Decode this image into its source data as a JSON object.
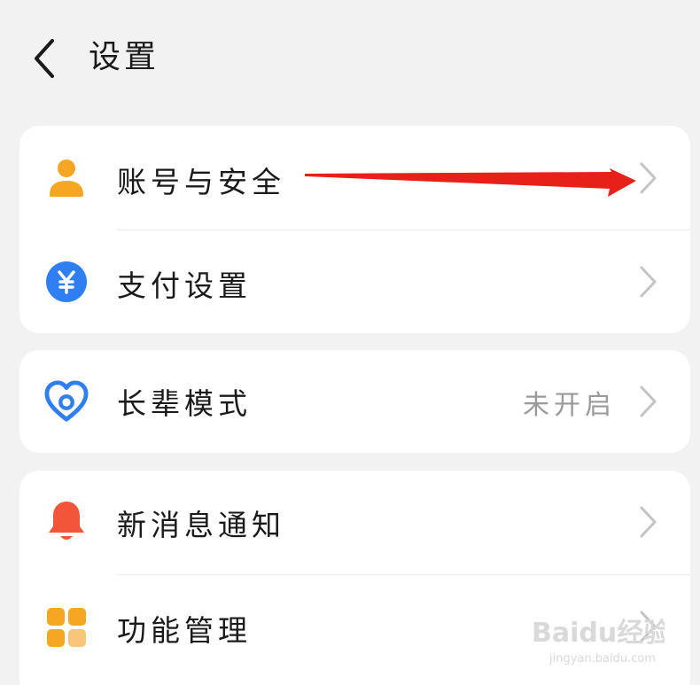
{
  "header": {
    "title": "设置",
    "back_icon": "chevron-left-icon"
  },
  "groups": [
    {
      "items": [
        {
          "label": "账号与安全",
          "icon": "account-icon",
          "icon_color": "#f5a623",
          "value": ""
        },
        {
          "label": "支付设置",
          "icon": "payment-icon",
          "icon_color": "#2f7ff3",
          "value": ""
        }
      ]
    },
    {
      "items": [
        {
          "label": "长辈模式",
          "icon": "elder-mode-icon",
          "icon_color": "#2f7ff3",
          "value": "未开启"
        }
      ]
    },
    {
      "items": [
        {
          "label": "新消息通知",
          "icon": "bell-icon",
          "icon_color": "#f2553a",
          "value": ""
        },
        {
          "label": "功能管理",
          "icon": "grid-icon",
          "icon_color": "#f5a623",
          "value": ""
        }
      ]
    }
  ],
  "colors": {
    "background": "#f2f2f2",
    "card": "#ffffff",
    "annotation_arrow": "#e8201a",
    "chevron": "#c4c4c4",
    "value_text": "#9a9a9a"
  },
  "watermark": {
    "brand": "Baidu经验",
    "url": "jingyan.baidu.com"
  }
}
